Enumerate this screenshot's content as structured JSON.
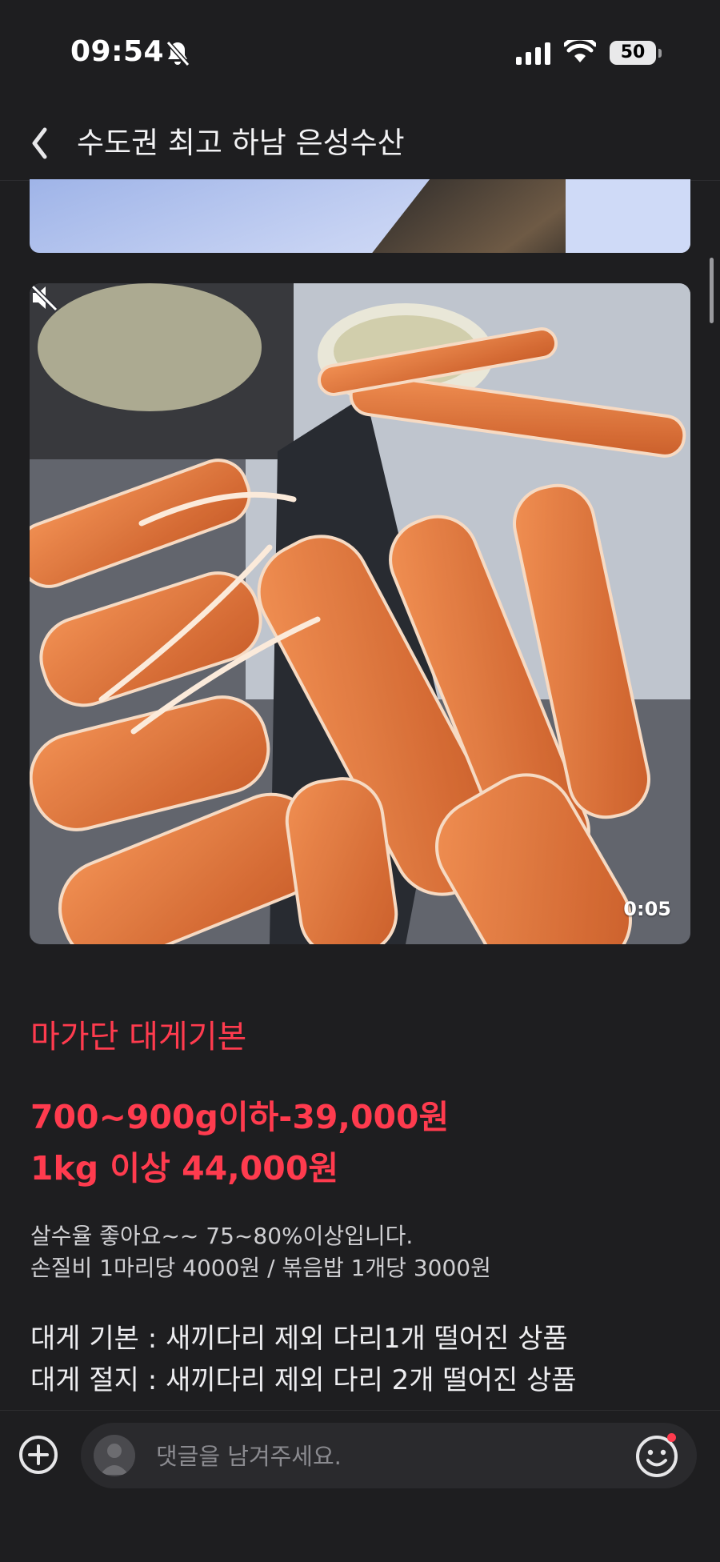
{
  "status_bar": {
    "time": "09:54",
    "battery": "50",
    "icons": [
      "bell-slash-icon",
      "cellular-signal-icon",
      "wifi-icon",
      "battery-icon"
    ]
  },
  "nav": {
    "back_icon": "chevron-left-icon",
    "title": "수도권 최고 하남 은성수산"
  },
  "media": {
    "video_duration": "0:05",
    "mute_icon": "speaker-muted-icon"
  },
  "post": {
    "headline": "마가단 대게기본",
    "price_line_1": "700~900g이하-39,000원",
    "price_line_2": "1kg 이상 44,000원",
    "desc_line_1": "살수율 좋아요~~ 75~80%이상입니다.",
    "desc_line_2": "손질비 1마리당 4000원 / 볶음밥 1개당 3000원",
    "def_line_1": "대게 기본 : 새끼다리 제외 다리1개 떨어진 상품",
    "def_line_2": "대게 절지 : 새끼다리 제외 다리 2개 떨어진 상품"
  },
  "comment_bar": {
    "placeholder": "댓글을 남겨주세요.",
    "icons": [
      "plus-circle-icon",
      "avatar-icon",
      "smiley-icon"
    ]
  },
  "colors": {
    "background": "#1e1e20",
    "accent_red": "#ff3b4e",
    "text_primary": "#ededf0"
  }
}
